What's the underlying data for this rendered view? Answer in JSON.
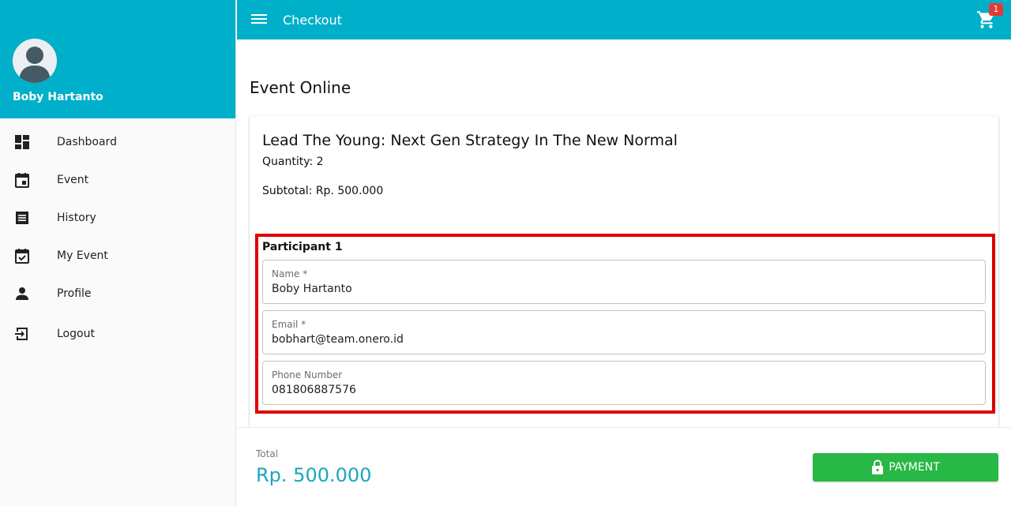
{
  "sidebar": {
    "user_name": "Boby Hartanto",
    "items": [
      {
        "label": "Dashboard",
        "icon": "dashboard-icon"
      },
      {
        "label": "Event",
        "icon": "calendar-icon"
      },
      {
        "label": "History",
        "icon": "history-list-icon"
      },
      {
        "label": "My Event",
        "icon": "calendar-check-icon"
      },
      {
        "label": "Profile",
        "icon": "person-icon"
      },
      {
        "label": "Logout",
        "icon": "logout-icon"
      }
    ]
  },
  "header": {
    "title": "Checkout",
    "cart_count": "1"
  },
  "main": {
    "section_title": "Event Online",
    "event_title": "Lead The Young: Next Gen Strategy In The New Normal",
    "quantity": "Quantity: 2",
    "subtotal": "Subtotal: Rp. 500.000",
    "participant": {
      "title": "Participant 1",
      "fields": [
        {
          "label": "Name *",
          "value": "Boby Hartanto"
        },
        {
          "label": "Email *",
          "value": "bobhart@team.onero.id"
        },
        {
          "label": "Phone Number",
          "value": "081806887576"
        }
      ]
    }
  },
  "footer": {
    "total_label": "Total",
    "total_value": "Rp. 500.000",
    "payment_label": "PAYMENT"
  },
  "colors": {
    "primary": "#00afc9",
    "payment": "#28b845",
    "highlight": "#e00000",
    "badge": "#e53935"
  }
}
